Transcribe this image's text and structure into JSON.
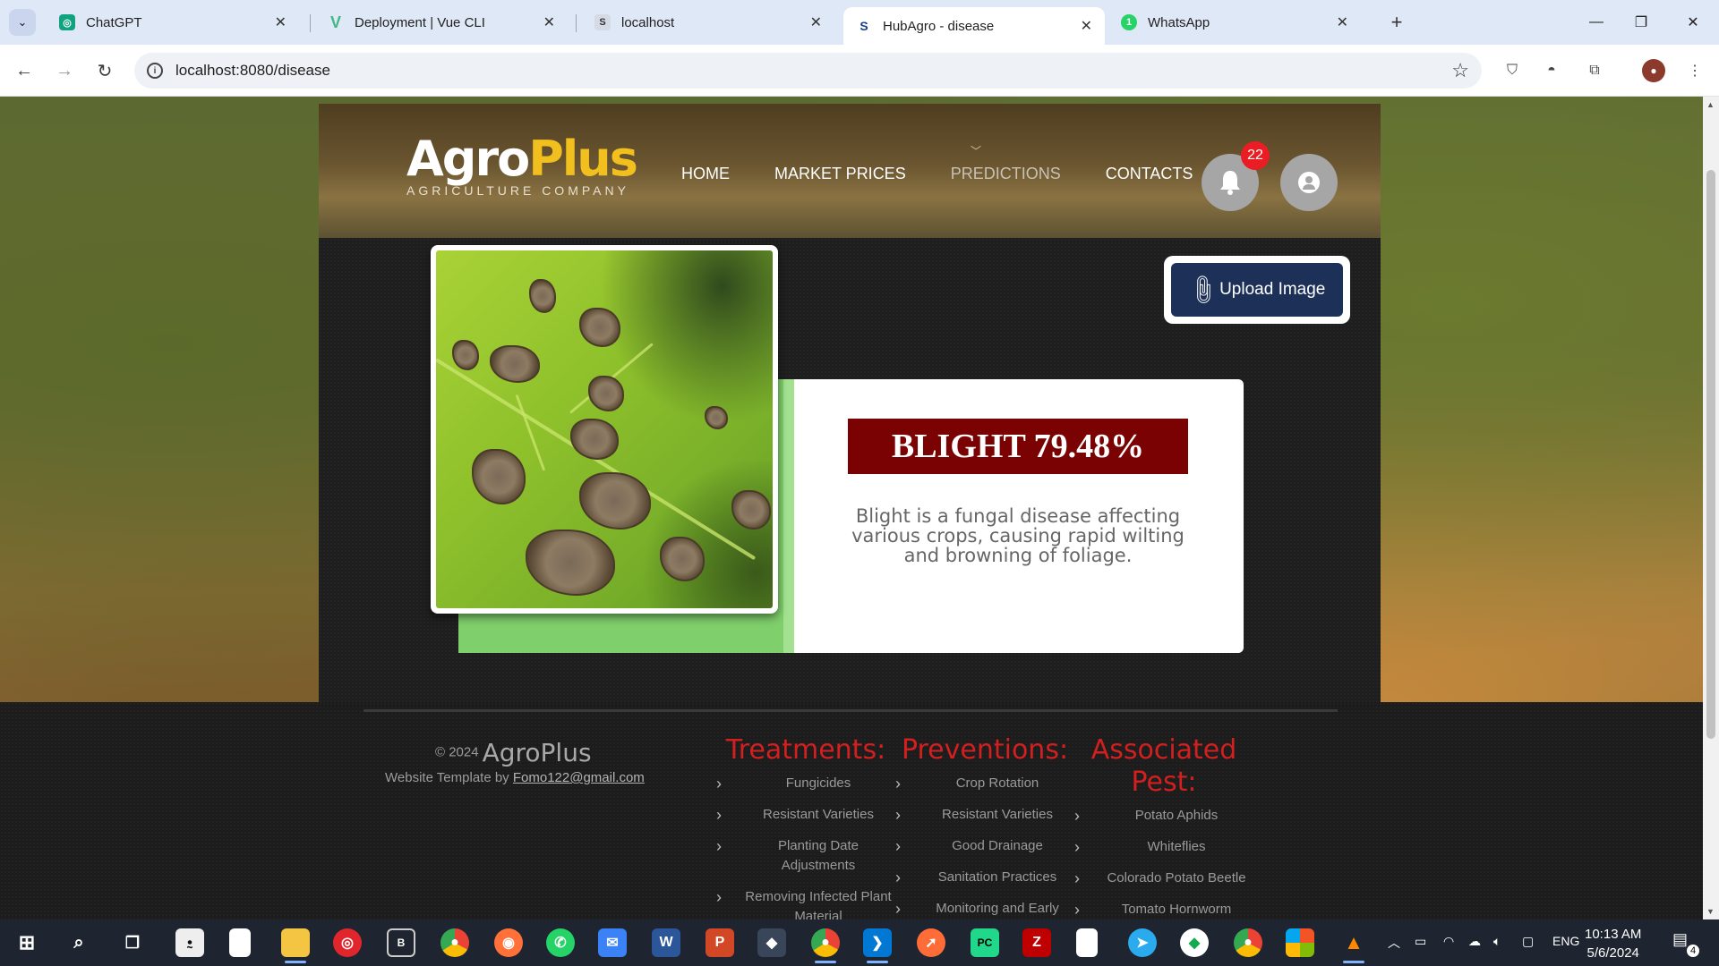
{
  "browser": {
    "tabs": [
      {
        "title": "ChatGPT",
        "icon": "chatgpt-icon",
        "color": "#10a37f",
        "glyph": "◎"
      },
      {
        "title": "Deployment | Vue CLI",
        "icon": "vue-icon",
        "color": "#41b883",
        "glyph": "V"
      },
      {
        "title": "localhost",
        "icon": "localhost-icon",
        "color": "#5f6368",
        "glyph": "S"
      },
      {
        "title": "HubAgro - disease",
        "icon": "hubagro-icon",
        "color": "#1a73e8",
        "glyph": "S",
        "active": true
      },
      {
        "title": "WhatsApp",
        "icon": "whatsapp-icon",
        "color": "#25d366",
        "glyph": "1"
      }
    ],
    "url": "localhost:8080/disease"
  },
  "site": {
    "logo": {
      "agro": "Agro",
      "plus": "Plus",
      "sub": "AGRICULTURE COMPANY"
    },
    "nav": [
      {
        "label": "HOME"
      },
      {
        "label": "MARKET PRICES"
      },
      {
        "label": "PREDICTIONS"
      },
      {
        "label": "CONTACTS"
      }
    ],
    "notifications": "22"
  },
  "result": {
    "title": "BLIGHT 79.48%",
    "description": "Blight is a fungal disease affecting various crops, causing rapid wilting and browning of foliage."
  },
  "upload": {
    "label": "Upload Image"
  },
  "footer": {
    "copyright": "© 2024",
    "brand": "AgroPlus",
    "template_prefix": "Website Template by ",
    "template_link": "Fomo122@gmail.com",
    "treatments": {
      "heading": "Treatments:",
      "items": [
        "Fungicides",
        "Resistant Varieties",
        "Planting Date Adjustments",
        "Removing Infected Plant Material"
      ]
    },
    "preventions": {
      "heading": "Preventions:",
      "items": [
        "Crop Rotation",
        "Resistant Varieties",
        "Good Drainage",
        "Sanitation Practices",
        "Monitoring and Early"
      ]
    },
    "pests": {
      "heading": "Associated Pest:",
      "items": [
        "Potato Aphids",
        "Whiteflies",
        "Colorado Potato Beetle",
        "Tomato Hornworm"
      ]
    }
  },
  "taskbar": {
    "lang": "ENG",
    "time": "10:13 AM",
    "date": "5/6/2024",
    "notif_count": "4"
  }
}
